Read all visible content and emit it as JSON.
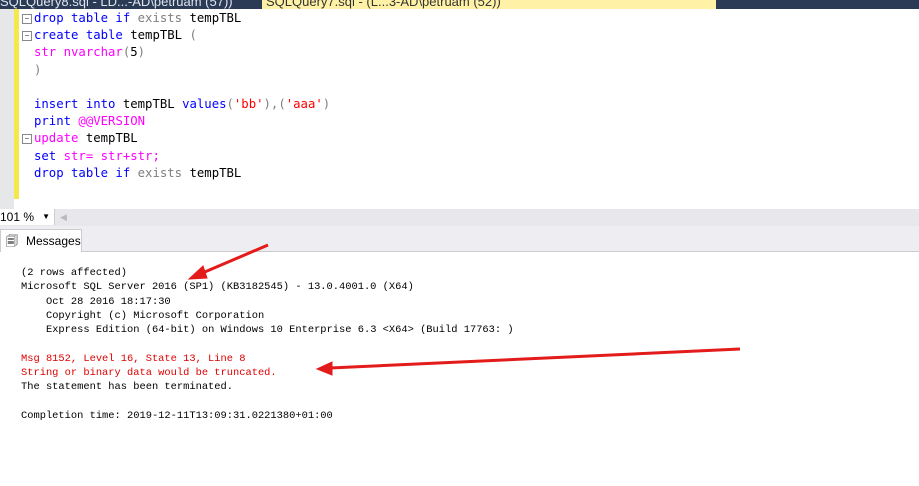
{
  "tabs": [
    {
      "label": "SQLQuery8.sql - LD...-AD\\petruam (57))"
    },
    {
      "label": "SQLQuery7.sql - (L...3-AD\\petruam (52))"
    }
  ],
  "editor": {
    "lines": [
      [
        {
          "t": "drop table if ",
          "c": "kw"
        },
        {
          "t": "exists ",
          "c": "gr"
        },
        {
          "t": "tempTBL",
          "c": "tx"
        }
      ],
      [
        {
          "t": "create table ",
          "c": "kw"
        },
        {
          "t": "tempTBL ",
          "c": "tx"
        },
        {
          "t": "(",
          "c": "gr"
        }
      ],
      [
        {
          "t": "str nvarchar",
          "c": "fn"
        },
        {
          "t": "(",
          "c": "gr"
        },
        {
          "t": "5",
          "c": "tx"
        },
        {
          "t": ")",
          "c": "gr"
        }
      ],
      [
        {
          "t": ")",
          "c": "gr"
        }
      ],
      [],
      [
        {
          "t": "insert into ",
          "c": "kw"
        },
        {
          "t": "tempTBL ",
          "c": "tx"
        },
        {
          "t": "values",
          "c": "kw"
        },
        {
          "t": "(",
          "c": "gr"
        },
        {
          "t": "'bb'",
          "c": "st"
        },
        {
          "t": "),(",
          "c": "gr"
        },
        {
          "t": "'aaa'",
          "c": "st"
        },
        {
          "t": ")",
          "c": "gr"
        }
      ],
      [
        {
          "t": "print ",
          "c": "kw"
        },
        {
          "t": "@@VERSION",
          "c": "fn"
        }
      ],
      [
        {
          "t": "update ",
          "c": "fn"
        },
        {
          "t": "tempTBL",
          "c": "tx"
        }
      ],
      [
        {
          "t": "set ",
          "c": "kw"
        },
        {
          "t": "str= str+str;",
          "c": "fn"
        }
      ],
      [
        {
          "t": "drop table if ",
          "c": "kw"
        },
        {
          "t": "exists ",
          "c": "gr"
        },
        {
          "t": "tempTBL",
          "c": "tx"
        }
      ]
    ],
    "folds": [
      0,
      1,
      7
    ]
  },
  "zoom": {
    "value": "101 %"
  },
  "results_tab": {
    "label": "Messages",
    "icon": "messages-icon"
  },
  "messages": [
    {
      "text": "(2 rows affected)",
      "error": false
    },
    {
      "text": "Microsoft SQL Server 2016 (SP1) (KB3182545) - 13.0.4001.0 (X64)",
      "error": false
    },
    {
      "text": "\tOct 28 2016 18:17:30",
      "error": false
    },
    {
      "text": "\tCopyright (c) Microsoft Corporation",
      "error": false
    },
    {
      "text": "\tExpress Edition (64-bit) on Windows 10 Enterprise 6.3 <X64> (Build 17763: )",
      "error": false
    },
    {
      "text": "",
      "error": false
    },
    {
      "text": "Msg 8152, Level 16, State 13, Line 8",
      "error": true
    },
    {
      "text": "String or binary data would be truncated.",
      "error": true
    },
    {
      "text": "The statement has been terminated.",
      "error": false
    },
    {
      "text": "",
      "error": false
    },
    {
      "text": "Completion time: 2019-12-11T13:09:31.0221380+01:00",
      "error": false
    }
  ],
  "colors": {
    "annotation_arrow": "#e31b1b"
  }
}
